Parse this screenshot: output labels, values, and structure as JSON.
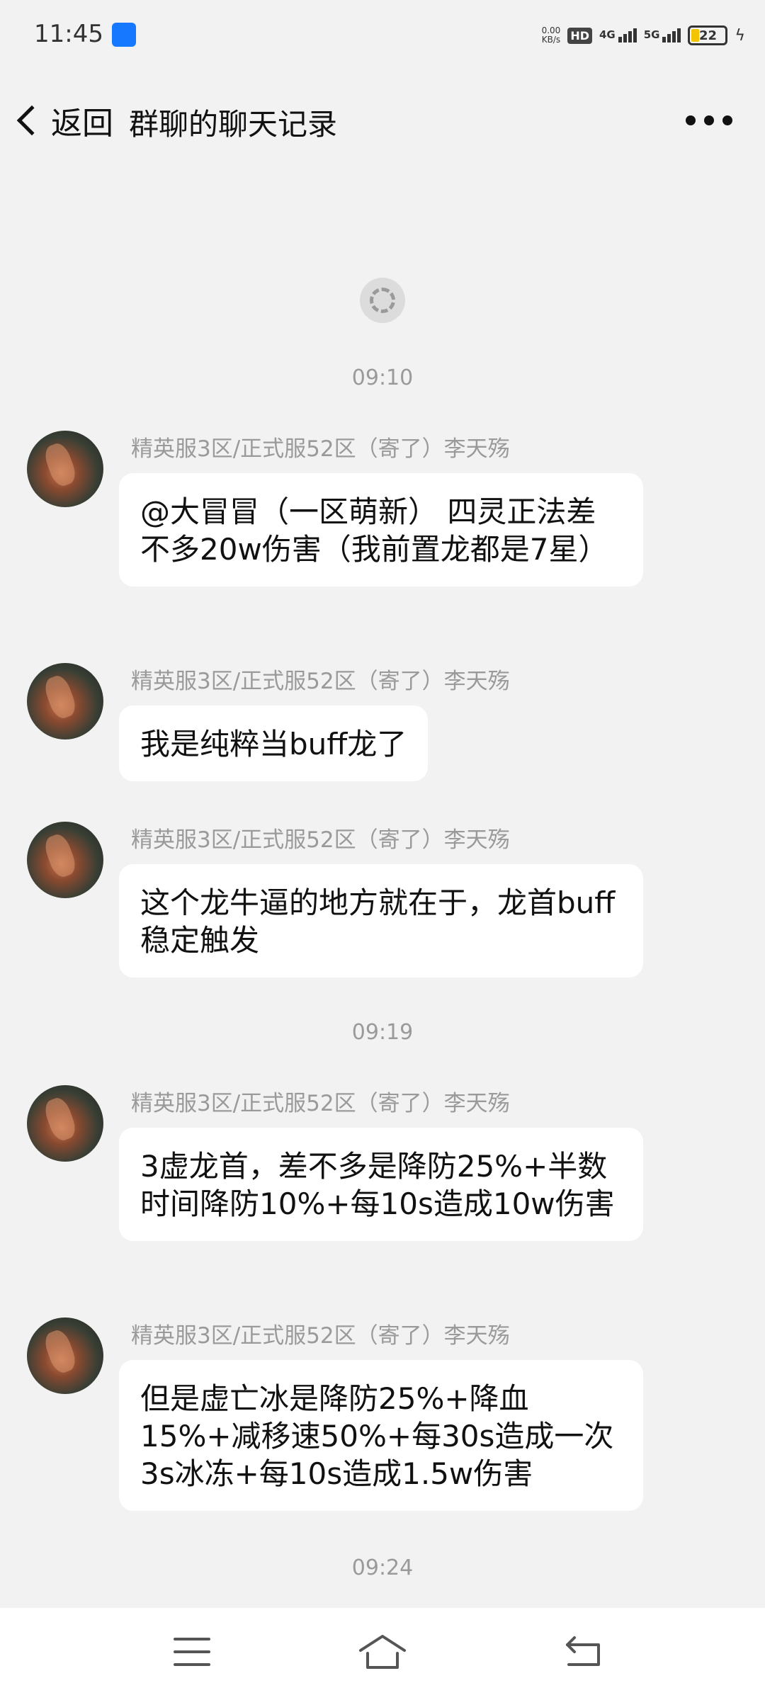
{
  "status_bar": {
    "time": "11:45",
    "net_speed_value": "0.00",
    "net_speed_unit": "KB/s",
    "hd_label": "HD",
    "sim1_label": "4G",
    "sim2_label": "5G",
    "battery_percent": "22",
    "battery_level": 0.22
  },
  "header": {
    "back_label": "返回",
    "title": "群聊的聊天记录"
  },
  "chat": {
    "time_1": "09:10",
    "time_2": "09:19",
    "time_3": "09:24",
    "messages": [
      {
        "sender": "精英服3区/正式服52区（寄了）李天殇",
        "text": "@大冒冒（一区萌新） 四灵正法差不多20w伤害（我前置龙都是7星）"
      },
      {
        "sender": "精英服3区/正式服52区（寄了）李天殇",
        "text": "我是纯粹当buff龙了"
      },
      {
        "sender": "精英服3区/正式服52区（寄了）李天殇",
        "text": "这个龙牛逼的地方就在于，龙首buff稳定触发"
      },
      {
        "sender": "精英服3区/正式服52区（寄了）李天殇",
        "text": "3虚龙首，差不多是降防25%+半数时间降防10%+每10s造成10w伤害"
      },
      {
        "sender": "精英服3区/正式服52区（寄了）李天殇",
        "text": "但是虚亡冰是降防25%+降血15%+减移速50%+每30s造成一次3s冰冻+每10s造成1.5w伤害"
      }
    ]
  },
  "colors": {
    "background": "#f2f2f3",
    "bubble": "#ffffff",
    "meta_text": "#9a9a9a",
    "battery": "#f4c400"
  }
}
